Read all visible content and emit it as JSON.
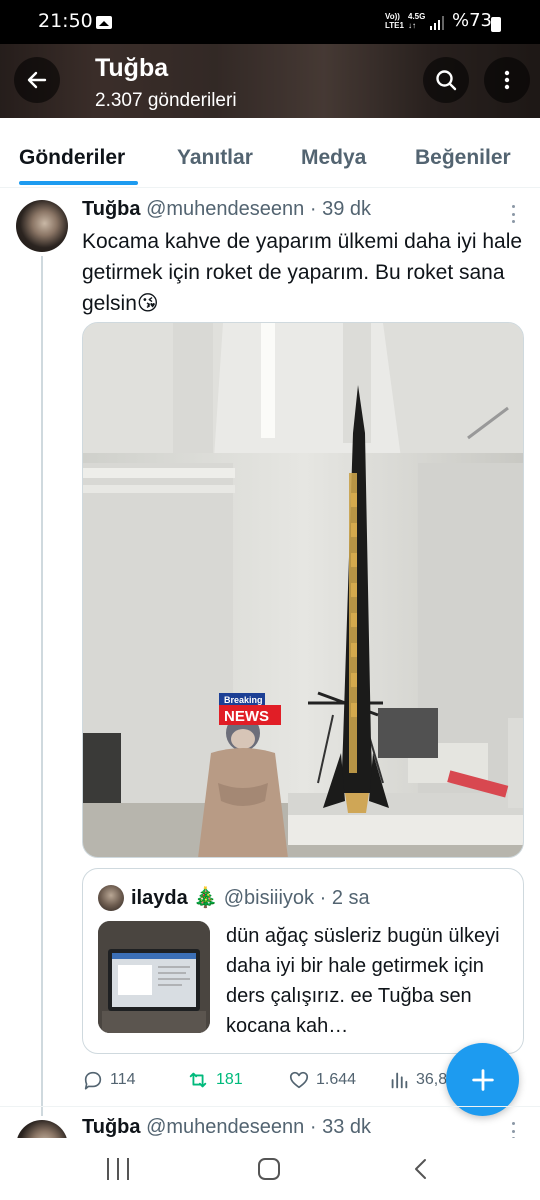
{
  "status_bar": {
    "time": "21:50",
    "network_top": "Vo))",
    "network_bottom": "LTE1",
    "network_type": "4.5G",
    "battery": "%73"
  },
  "header": {
    "title": "Tuğba",
    "subtitle": "2.307 gönderileri"
  },
  "tabs": [
    {
      "label": "Gönderiler",
      "active": true
    },
    {
      "label": "Yanıtlar",
      "active": false
    },
    {
      "label": "Medya",
      "active": false
    },
    {
      "label": "Beğeniler",
      "active": false
    }
  ],
  "tweet": {
    "name": "Tuğba",
    "handle": "@muhendeseenn",
    "separator": "·",
    "time": "39 dk",
    "text": "Kocama kahve de yaparım ülkemi daha iyi hale getirmek için roket de yaparım. Bu roket sana gelsin😘",
    "media_badge_top": "Breaking",
    "media_badge_bottom": "NEWS",
    "quote": {
      "name": "ilayda 🎄",
      "handle": "@bisiiiyok",
      "separator": "·",
      "time": "2 sa",
      "text": "dün ağaç süsleriz bugün ülkeyi daha iyi bir hale getirmek için ders çalışırız. ee Tuğba sen kocana kah…"
    },
    "actions": {
      "replies": "114",
      "retweets": "181",
      "likes": "1.644",
      "views": "36,8"
    }
  },
  "tweet2": {
    "name": "Tuğba",
    "handle": "@muhendeseenn",
    "separator": "·",
    "time": "33 dk"
  },
  "colors": {
    "accent": "#1d9bf0",
    "retweet": "#00ba7c",
    "secondary_text": "#536471"
  }
}
